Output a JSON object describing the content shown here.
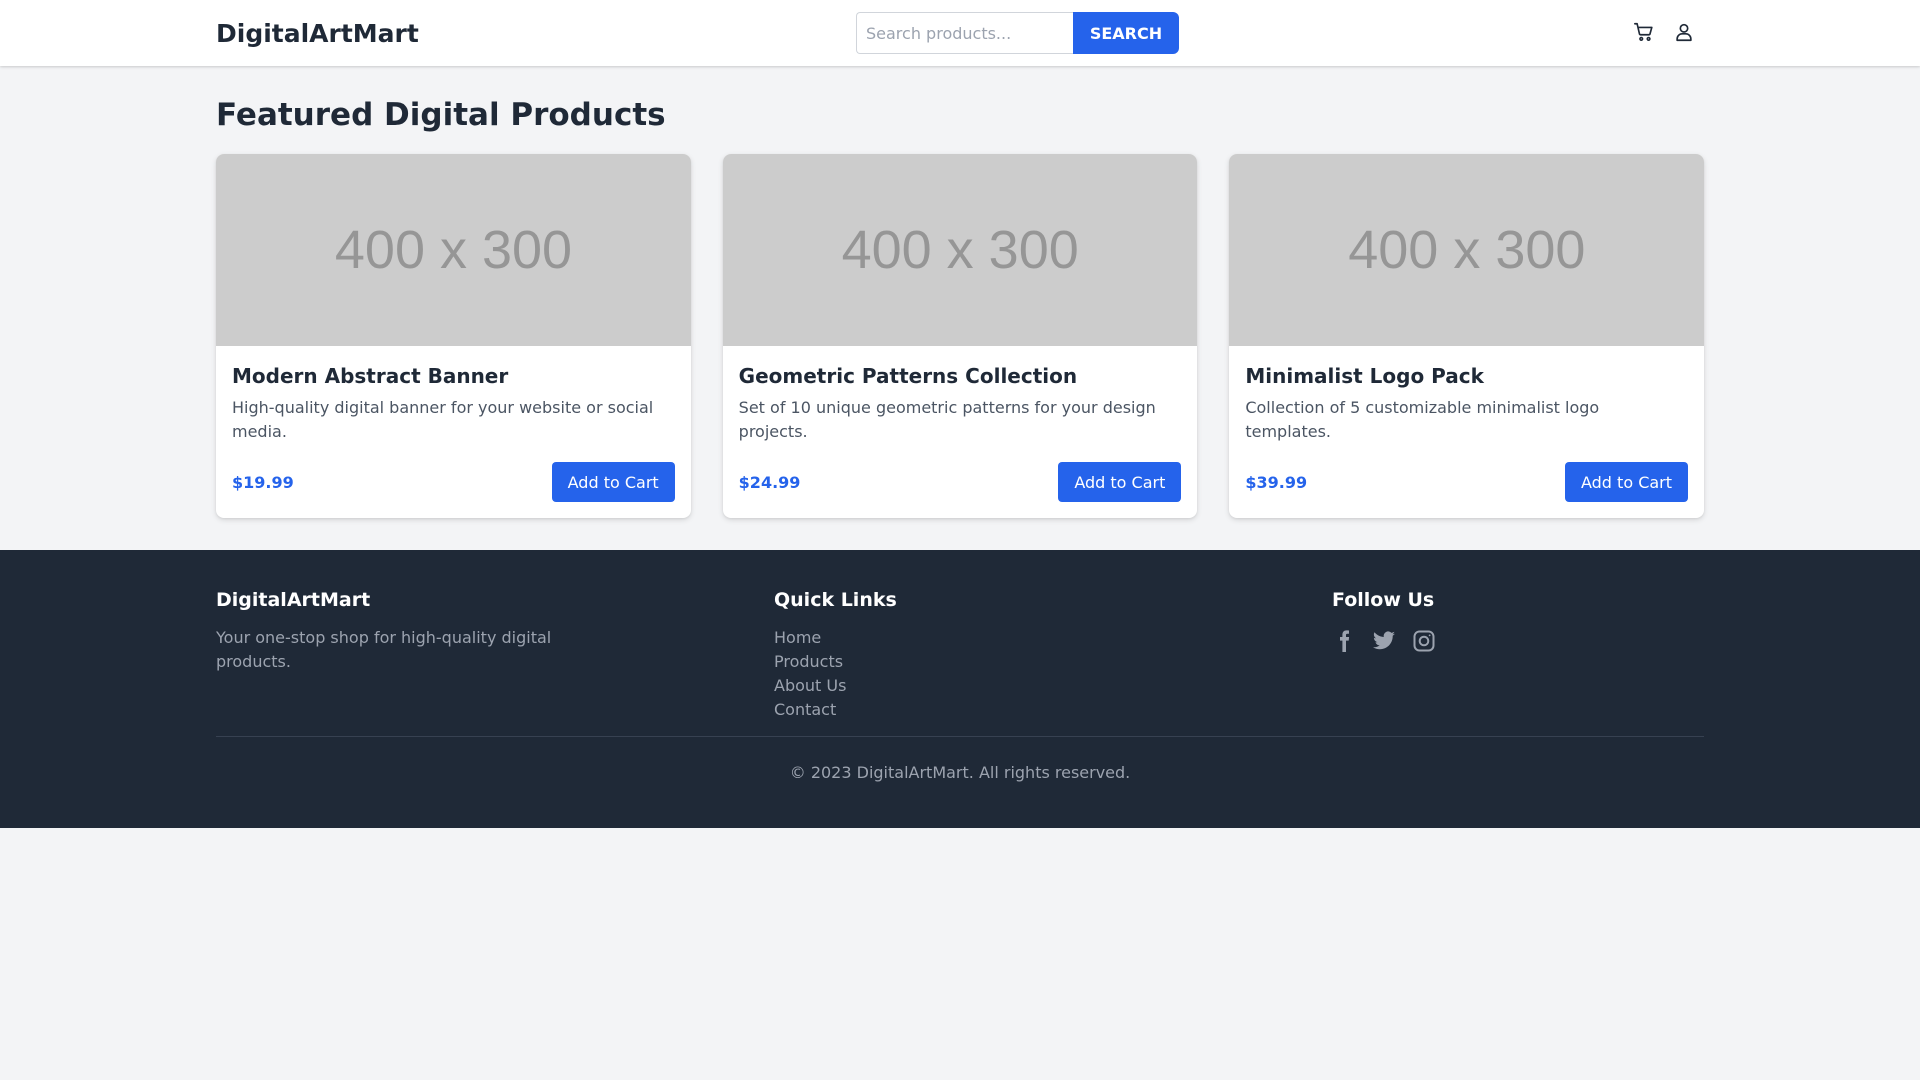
{
  "header": {
    "logo": "DigitalArtMart",
    "search": {
      "placeholder": "Search products...",
      "value": "",
      "button_label": "SEARCH"
    },
    "icons": [
      "cart-icon",
      "user-icon"
    ]
  },
  "main": {
    "title": "Featured Digital Products",
    "products": [
      {
        "image_label": "400 x 300",
        "name": "Modern Abstract Banner",
        "description": "High-quality digital banner for your website or social media.",
        "price": "$19.99",
        "button_label": "Add to Cart"
      },
      {
        "image_label": "400 x 300",
        "name": "Geometric Patterns Collection",
        "description": "Set of 10 unique geometric patterns for your design projects.",
        "price": "$24.99",
        "button_label": "Add to Cart"
      },
      {
        "image_label": "400 x 300",
        "name": "Minimalist Logo Pack",
        "description": "Collection of 5 customizable minimalist logo templates.",
        "price": "$39.99",
        "button_label": "Add to Cart"
      }
    ]
  },
  "footer": {
    "brand": {
      "title": "DigitalArtMart",
      "text": "Your one-stop shop for high-quality digital products."
    },
    "quick_links": {
      "title": "Quick Links",
      "items": [
        "Home",
        "Products",
        "About Us",
        "Contact"
      ]
    },
    "follow": {
      "title": "Follow Us",
      "icons": [
        "facebook-icon",
        "twitter-icon",
        "instagram-icon"
      ]
    },
    "copyright": "© 2023 DigitalArtMart. All rights reserved."
  },
  "colors": {
    "accent": "#2563eb",
    "footer_bg": "#1f2937",
    "page_bg": "#f3f4f6",
    "placeholder_bg": "#cccccc"
  }
}
